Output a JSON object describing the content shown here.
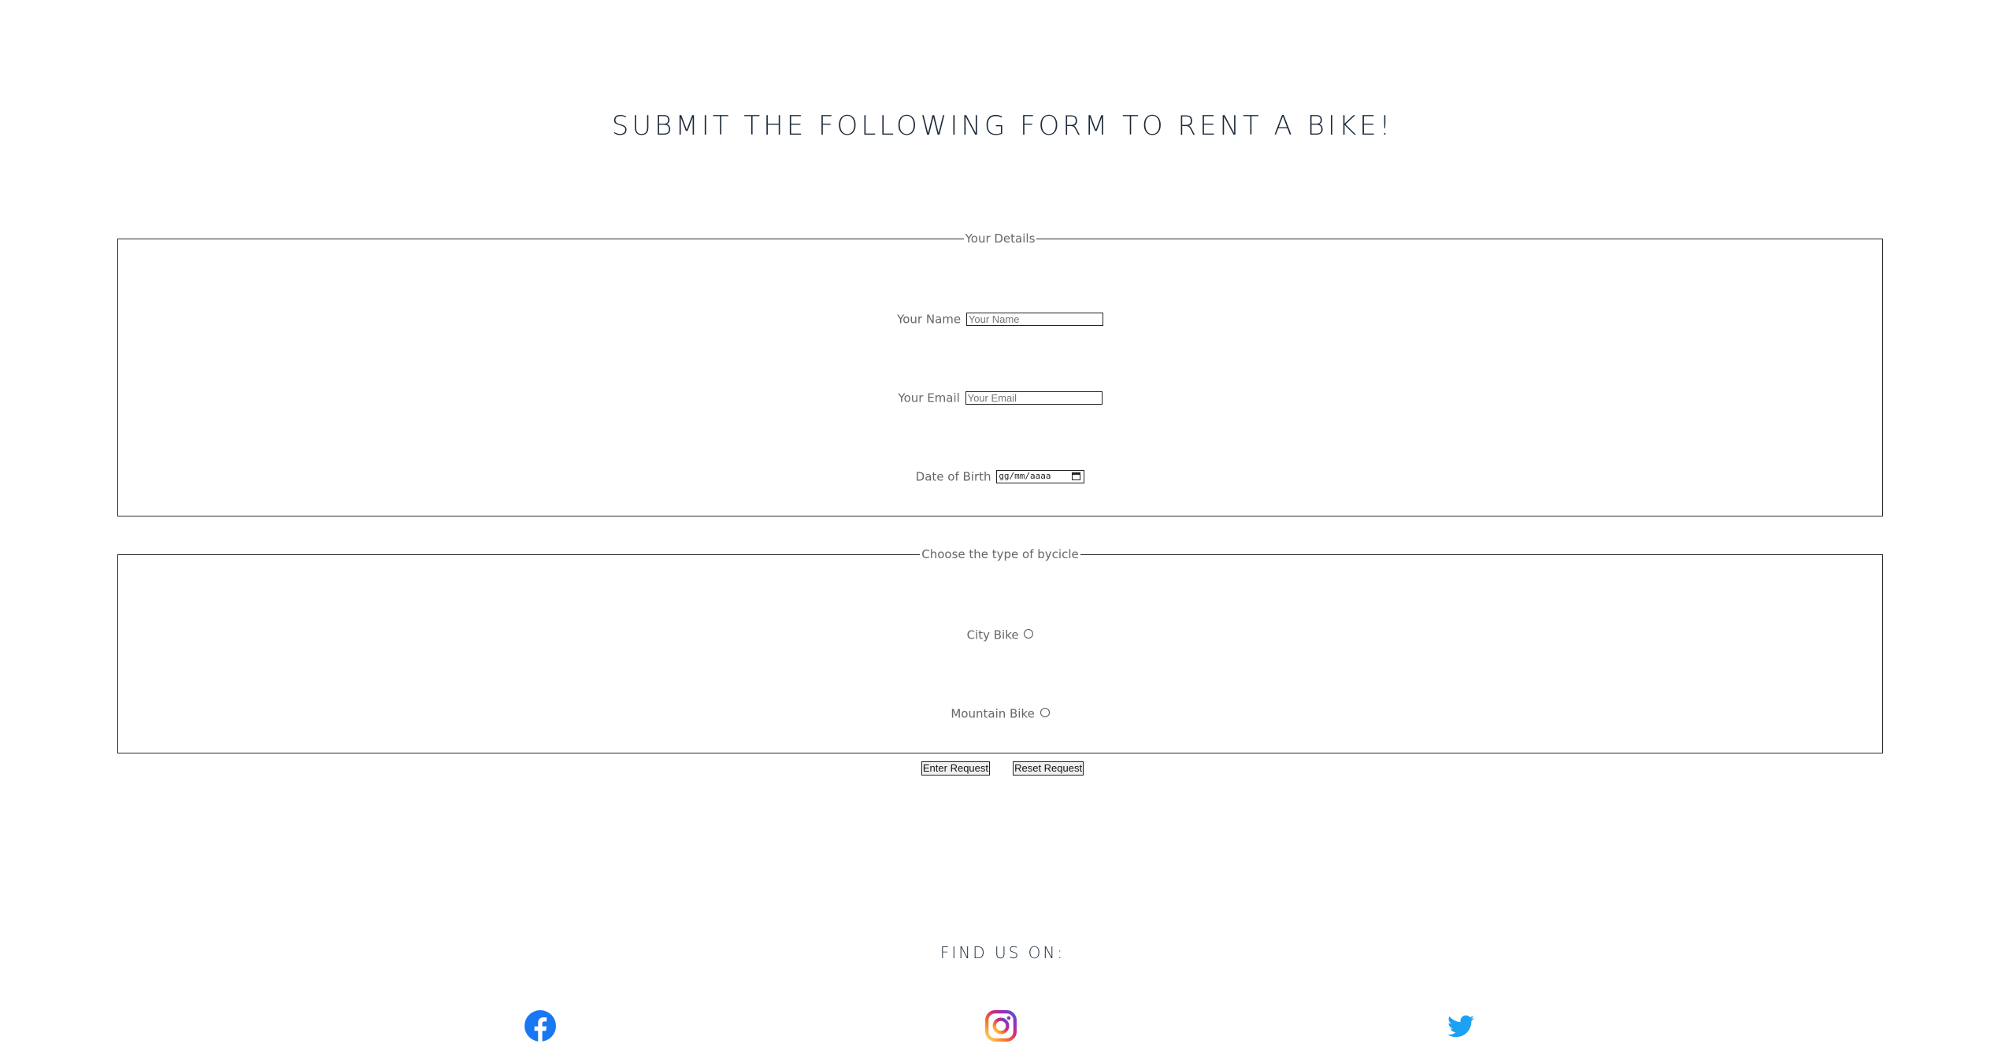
{
  "page": {
    "title": "SUBMIT THE FOLLOWING FORM TO RENT A BIKE!"
  },
  "details": {
    "legend": "Your Details",
    "name_label": "Your Name",
    "name_placeholder": "Your Name",
    "email_label": "Your Email",
    "email_placeholder": "Your Email",
    "dob_label": "Date of Birth",
    "dob_placeholder": "gg/mm/aaaa"
  },
  "bike": {
    "legend": "Choose the type of bycicle",
    "options": [
      "City Bike",
      "Mountain Bike"
    ]
  },
  "buttons": {
    "submit": "Enter Request",
    "reset": "Reset Request"
  },
  "footer": {
    "find_us": "FIND US ON:",
    "social": [
      {
        "icon": "facebook-icon",
        "color": "#1877f2"
      },
      {
        "icon": "instagram-icon",
        "color": "#d62976"
      },
      {
        "icon": "twitter-icon",
        "color": "#1da1f2"
      }
    ]
  }
}
